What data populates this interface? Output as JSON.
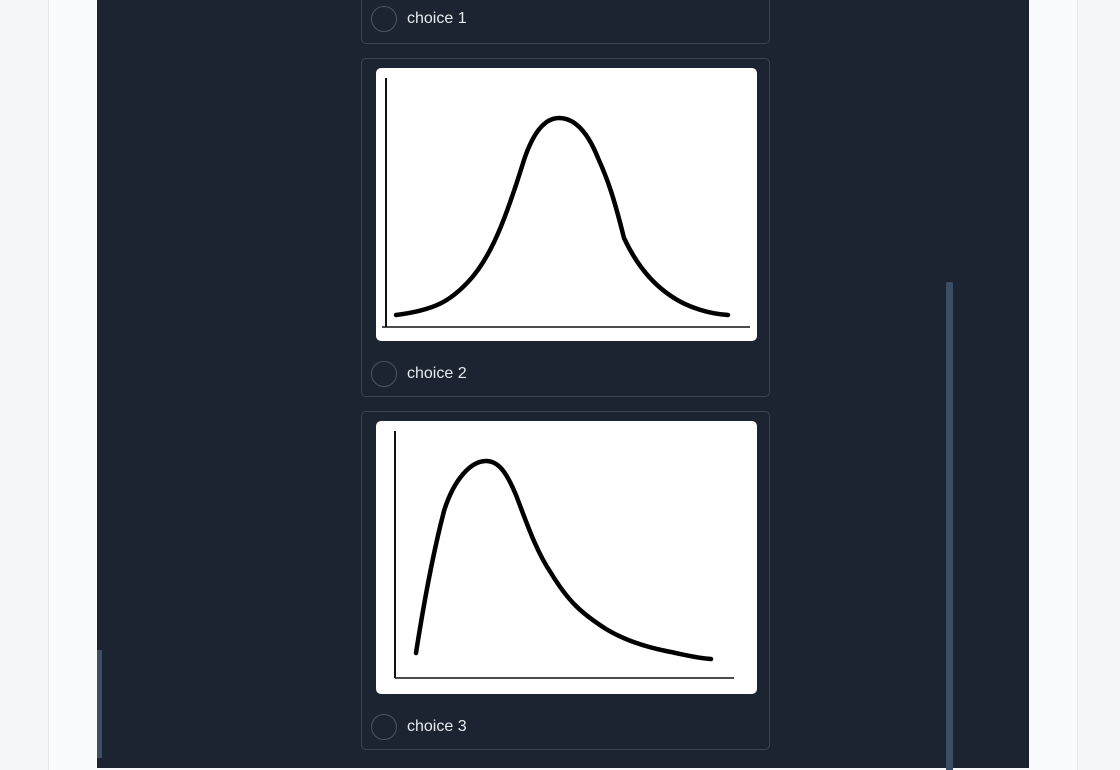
{
  "choices": [
    {
      "label": "choice 1",
      "image": null
    },
    {
      "label": "choice 2",
      "image": "symmetric-bell-curve"
    },
    {
      "label": "choice 3",
      "image": "right-skewed-curve"
    }
  ],
  "colors": {
    "panel_background": "#1b2430",
    "card_border": "#3a4452",
    "label_text": "#e6eaef",
    "scrollbar": "#3c4e66"
  }
}
